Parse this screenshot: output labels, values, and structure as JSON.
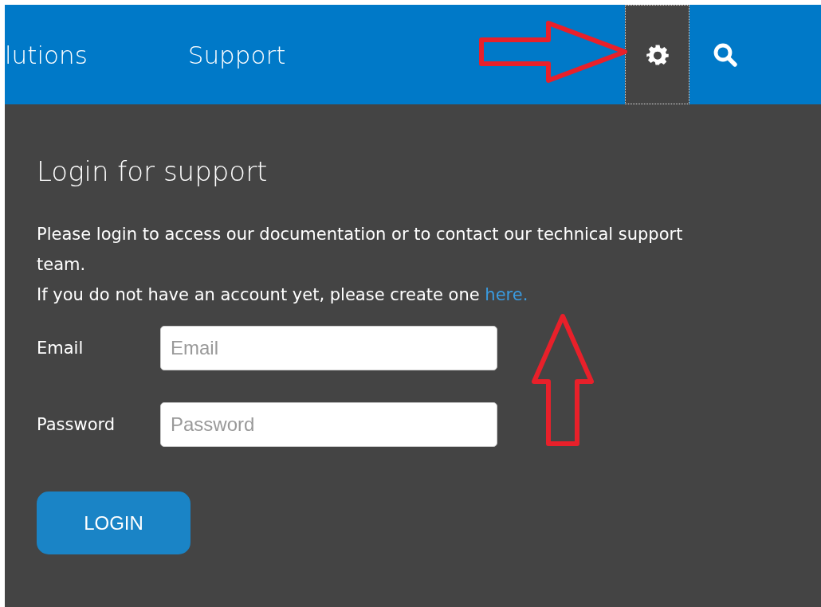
{
  "nav": {
    "items": [
      {
        "label": "lutions"
      },
      {
        "label": "Support"
      }
    ],
    "settings": {
      "active": true
    }
  },
  "login": {
    "title": "Login for support",
    "intro": "Please login to access our documentation or to contact our technical support team.",
    "account_prompt": "If you do not have an account yet, please create one",
    "account_link": "here.",
    "fields": [
      {
        "label": "Email",
        "placeholder": "Email"
      },
      {
        "label": "Password",
        "placeholder": "Password"
      }
    ],
    "button": "LOGIN"
  }
}
